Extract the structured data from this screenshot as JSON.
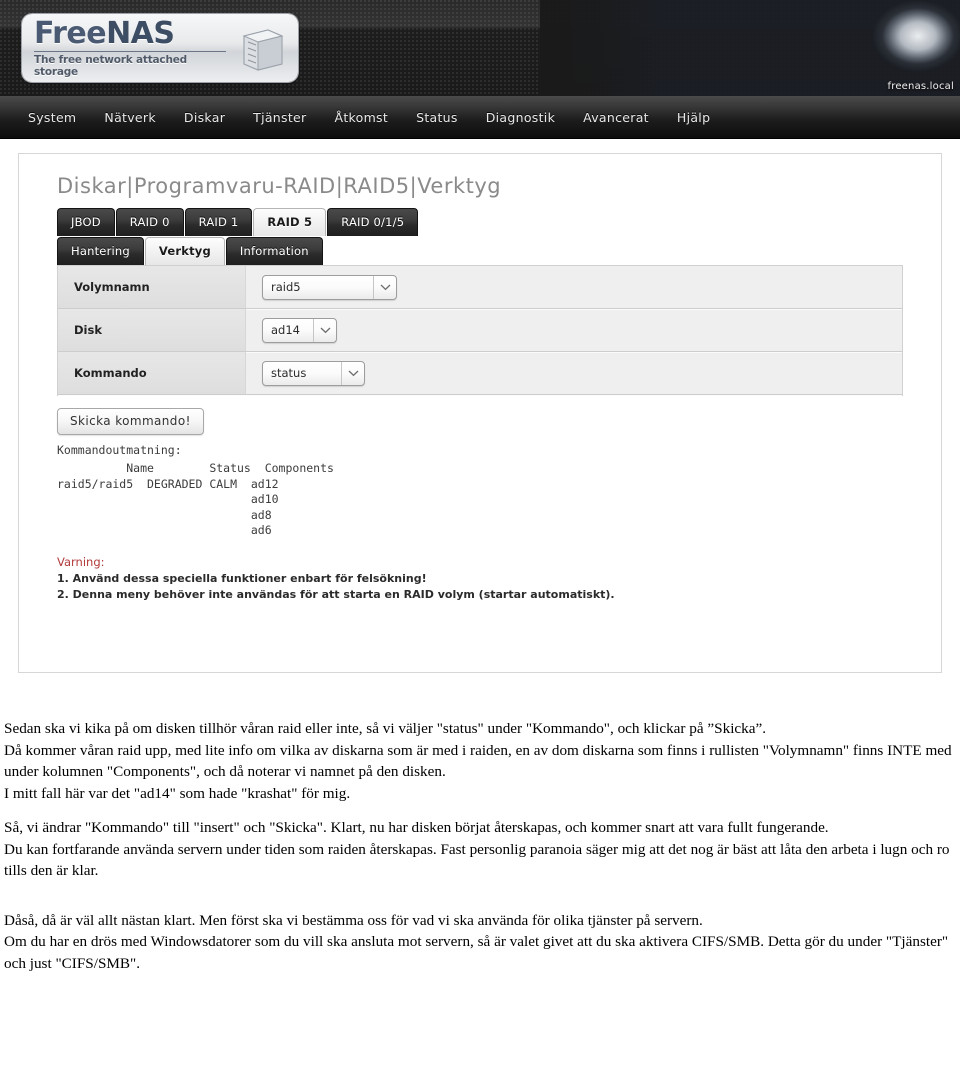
{
  "app": {
    "logo_title_a": "Free",
    "logo_title_b": "NAS",
    "logo_tagline": "The free network attached storage",
    "hostname": "freenas.local"
  },
  "nav": {
    "items": [
      {
        "label": "System"
      },
      {
        "label": "Nätverk"
      },
      {
        "label": "Diskar"
      },
      {
        "label": "Tjänster"
      },
      {
        "label": "Åtkomst"
      },
      {
        "label": "Status"
      },
      {
        "label": "Diagnostik"
      },
      {
        "label": "Avancerat"
      },
      {
        "label": "Hjälp"
      }
    ]
  },
  "page": {
    "breadcrumb": "Diskar|Programvaru-RAID|RAID5|Verktyg",
    "tabs_primary": [
      {
        "label": "JBOD",
        "active": false
      },
      {
        "label": "RAID 0",
        "active": false
      },
      {
        "label": "RAID 1",
        "active": false
      },
      {
        "label": "RAID 5",
        "active": true
      },
      {
        "label": "RAID 0/1/5",
        "active": false
      }
    ],
    "tabs_secondary": [
      {
        "label": "Hantering",
        "active": false
      },
      {
        "label": "Verktyg",
        "active": true
      },
      {
        "label": "Information",
        "active": false
      }
    ]
  },
  "form": {
    "rows": [
      {
        "label": "Volymnamn",
        "value": "raid5"
      },
      {
        "label": "Disk",
        "value": "ad14"
      },
      {
        "label": "Kommando",
        "value": "status"
      }
    ],
    "submit_label": "Skicka kommando!"
  },
  "output": {
    "label": "Kommandoutmatning:",
    "text": "          Name        Status  Components\nraid5/raid5  DEGRADED CALM  ad12\n                            ad10\n                            ad8\n                            ad6"
  },
  "warning": {
    "title": "Varning:",
    "lines": [
      "1. Använd dessa speciella funktioner enbart för felsökning!",
      "2. Denna meny behöver inte användas för att starta en RAID volym (startar automatiskt)."
    ]
  },
  "article": {
    "p1": "Sedan ska vi kika på om disken tillhör våran raid eller inte, så vi väljer \"status\" under \"Kommando\", och klickar på ”Skicka”.",
    "p2": "Då kommer våran raid upp, med lite info om vilka av diskarna som är med i raiden, en av dom diskarna som finns i rullisten \"Volymnamn\" finns INTE med under kolumnen \"Components\", och då noterar vi namnet på den disken.",
    "p3": "I mitt fall här var det \"ad14\" som hade \"krashat\" för mig.",
    "p4": "Så, vi ändrar \"Kommando\" till \"insert\" och \"Skicka\". Klart, nu har disken börjat återskapas, och kommer snart att vara fullt fungerande.",
    "p5": "Du kan fortfarande använda servern under tiden som raiden återskapas. Fast personlig paranoia säger mig att det nog är bäst att låta den arbeta i lugn och ro tills den är klar.",
    "p6": "Dåså, då är väl allt nästan klart. Men först ska vi bestämma oss för vad vi ska använda för olika tjänster på servern.",
    "p7": "Om du har en drös med Windowsdatorer som du vill ska ansluta mot servern, så är valet givet att du ska aktivera CIFS/SMB. Detta gör du under \"Tjänster\" och just \"CIFS/SMB\"."
  },
  "colors": {
    "nav_bg": "#1c1c1c",
    "accent_warning": "#b33a3a",
    "logo_blue": "#4a5a72",
    "panel_bg": "#efefef"
  }
}
